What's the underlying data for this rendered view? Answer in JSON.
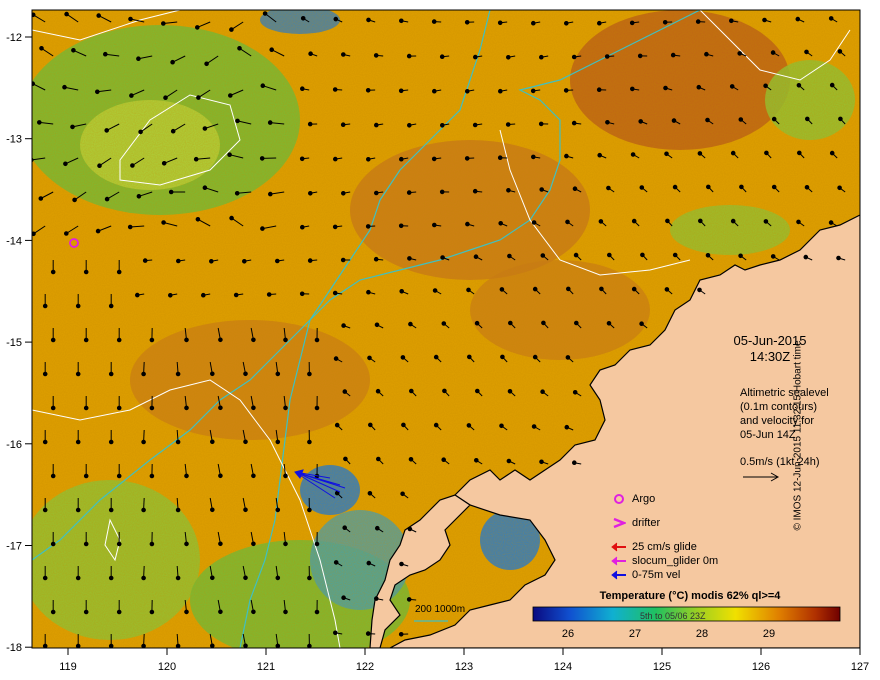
{
  "map": {
    "x_ticks": [
      "119",
      "120",
      "121",
      "122",
      "123",
      "124",
      "125",
      "126",
      "127"
    ],
    "y_ticks": [
      "-12",
      "-13",
      "-14",
      "-15",
      "-16",
      "-17",
      "-18"
    ],
    "colors": {
      "ocean_warm": "#e0a000",
      "ocean_hot": "#c46a10",
      "ocean_cool": "#6fbf3a",
      "ocean_cold": "#1e7ad8",
      "land": "#f5c8a0",
      "isobath": "#40c0c0",
      "contour": "#ffffff"
    }
  },
  "info": {
    "date": "05-Jun-2015",
    "time": "14:30Z",
    "altimetry_lines": [
      "Altimetric sealevel",
      "(0.1m contours)",
      "and velocity for",
      "05-Jun 14Z",
      "0.5m/s (1kt 24h)"
    ]
  },
  "legend": {
    "argo": "Argo",
    "drifter": "drifter",
    "glide": "25 cm/s glide",
    "slocum": "slocum_glider 0m",
    "vel": "0-75m vel",
    "subdate": "5th to 05/06 23Z",
    "isobaths": "200  1000m"
  },
  "colorbar": {
    "title": "Temperature (°C) modis 62% ql>=4",
    "ticks": [
      "26",
      "27",
      "28",
      "29"
    ]
  },
  "credit": "© IMOS 12-Jun-2015 11:32:15 Hobart time"
}
